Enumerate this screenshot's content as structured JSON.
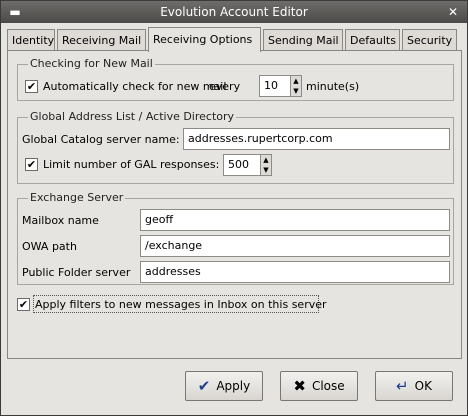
{
  "window": {
    "title": "Evolution Account Editor"
  },
  "titlebar_icons": {
    "menu": "window-menu-icon",
    "close": "close-icon"
  },
  "tabs": [
    {
      "label": "Identity"
    },
    {
      "label": "Receiving Mail"
    },
    {
      "label": "Receiving Options"
    },
    {
      "label": "Sending Mail"
    },
    {
      "label": "Defaults"
    },
    {
      "label": "Security"
    }
  ],
  "active_tab": "Receiving Options",
  "checking": {
    "legend": "Checking for New Mail",
    "auto_check_checked": true,
    "auto_check_label": "Automatically check for new mail",
    "every_label": "every",
    "interval_value": "10",
    "unit_label": "minute(s)"
  },
  "gal": {
    "legend": "Global Address List / Active Directory",
    "server_label": "Global Catalog server name:",
    "server_value": "addresses.rupertcorp.com",
    "limit_checked": true,
    "limit_label": "Limit number of GAL responses:",
    "limit_value": "500"
  },
  "exchange": {
    "legend": "Exchange Server",
    "mailbox_label": "Mailbox name",
    "mailbox_value": "geoff",
    "owa_label": "OWA path",
    "owa_value": "/exchange",
    "public_folder_label": "Public Folder server",
    "public_folder_value": "addresses"
  },
  "filters": {
    "checked": true,
    "label": "Apply filters to new messages in Inbox on this server"
  },
  "buttons": {
    "apply": {
      "label": "Apply",
      "icon": "checkmark-icon"
    },
    "close": {
      "label": "Close",
      "icon": "x-icon"
    },
    "ok": {
      "label": "OK",
      "icon": "enter-arrow-icon"
    }
  }
}
